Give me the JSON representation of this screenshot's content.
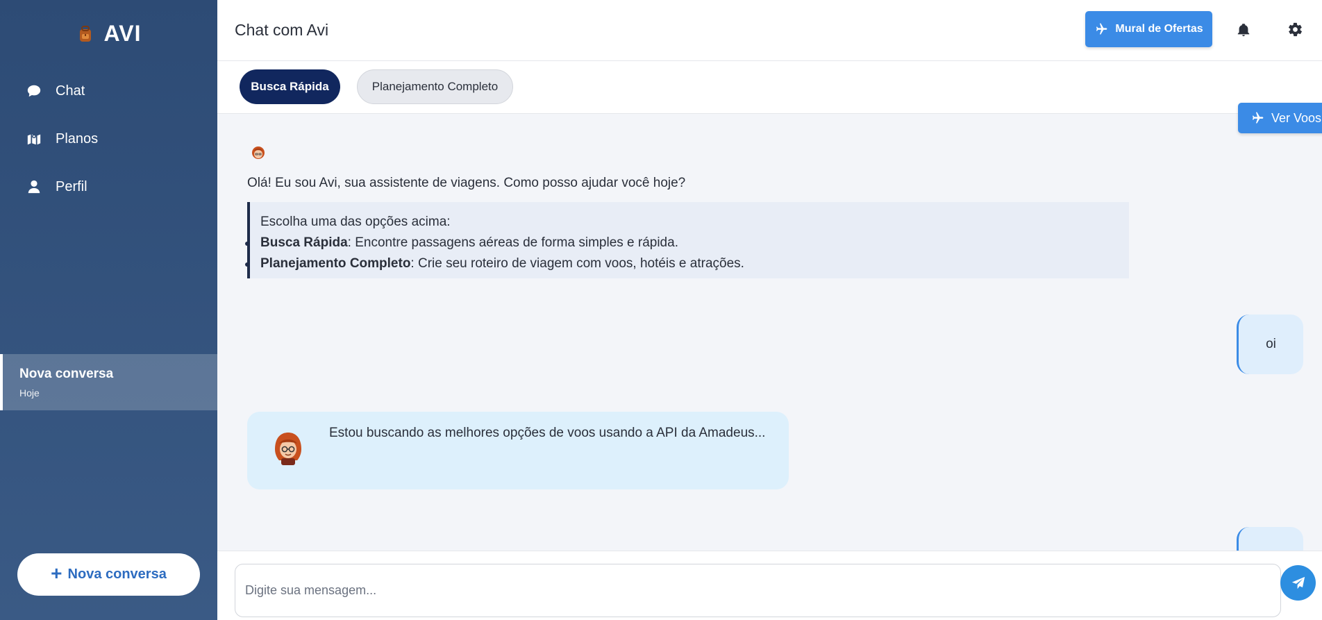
{
  "sidebar": {
    "brand": "AVI",
    "nav": [
      {
        "label": "Chat",
        "icon": "chat-bubble-icon"
      },
      {
        "label": "Planos",
        "icon": "map-location-icon"
      },
      {
        "label": "Perfil",
        "icon": "user-icon"
      }
    ],
    "conversation": {
      "title": "Nova conversa",
      "date": "Hoje"
    },
    "new_conversation_button": {
      "plus": "+",
      "label": "Nova conversa"
    }
  },
  "header": {
    "title": "Chat com Avi",
    "offers_button": "Mural de Ofertas"
  },
  "modes": {
    "active": "Busca Rápida",
    "inactive": "Planejamento Completo"
  },
  "flights_tab": "Ver Voos",
  "chat": {
    "greeting": "Olá! Eu sou Avi, sua assistente de viagens. Como posso ajudar você hoje?",
    "options_intro": "Escolha uma das opções acima:",
    "options": [
      {
        "name": "Busca Rápida",
        "desc": ": Encontre passagens aéreas de forma simples e rápida."
      },
      {
        "name": "Planejamento Completo",
        "desc": ": Crie seu roteiro de viagem com voos, hotéis e atrações."
      }
    ],
    "user_message": "oi",
    "bot_message": "Estou buscando as melhores opções de voos usando a API da Amadeus..."
  },
  "input": {
    "placeholder": "Digite sua mensagem..."
  },
  "colors": {
    "sidebar": "#2d4b75",
    "accent": "#3b8be6",
    "active_mode": "#11275e"
  }
}
